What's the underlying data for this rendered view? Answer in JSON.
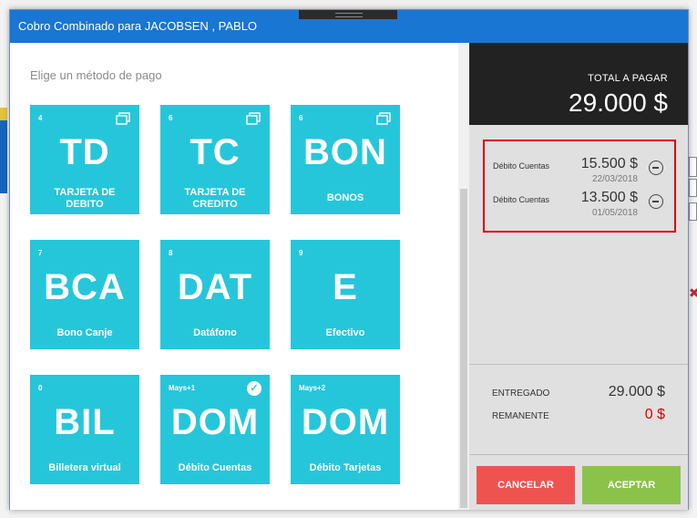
{
  "window": {
    "title": "Cobro Combinado para JACOBSEN , PABLO"
  },
  "left_panel": {
    "subtitle": "Elige un método de pago",
    "tiles": [
      {
        "key": "4",
        "code": "TD",
        "label": "TARJETA DE DEBITO",
        "label_lines": [
          "TARJETA DE",
          "DEBITO"
        ],
        "icon": "duplicate-icon"
      },
      {
        "key": "6",
        "code": "TC",
        "label": "TARJETA DE CREDITO",
        "label_lines": [
          "TARJETA DE",
          "CREDITO"
        ],
        "icon": "duplicate-icon"
      },
      {
        "key": "6",
        "code": "BON",
        "label": "BONOS",
        "label_lines": [
          "BONOS"
        ],
        "icon": "duplicate-icon"
      },
      {
        "key": "7",
        "code": "BCA",
        "label": "Bono Canje",
        "label_lines": [
          "Bono Canje"
        ]
      },
      {
        "key": "8",
        "code": "DAT",
        "label": "Datáfono",
        "label_lines": [
          "Datáfono"
        ]
      },
      {
        "key": "9",
        "code": "E",
        "label": "Efectivo",
        "label_lines": [
          "Efectivo"
        ]
      },
      {
        "key": "0",
        "code": "BIL",
        "label": "Billetera virtual",
        "label_lines": [
          "Billetera virtual"
        ]
      },
      {
        "key": "Mays+1",
        "code": "DOM",
        "label": "Débito Cuentas",
        "label_lines": [
          "Débito Cuentas"
        ],
        "icon": "check-icon",
        "selected": true
      },
      {
        "key": "Mays+2",
        "code": "DOM",
        "label": "Débito Tarjetas",
        "label_lines": [
          "Débito Tarjetas"
        ]
      }
    ]
  },
  "right_panel": {
    "total_label": "TOTAL A PAGAR",
    "total_value": "29.000 $",
    "payments": [
      {
        "method": "Débito Cuentas",
        "amount": "15.500 $",
        "date": "22/03/2018"
      },
      {
        "method": "Débito Cuentas",
        "amount": "13.500 $",
        "date": "01/05/2018"
      }
    ],
    "delivered_label": "ENTREGADO",
    "delivered_value": "29.000 $",
    "remaining_label": "REMANENTE",
    "remaining_value": "0 $",
    "cancel_label": "CANCELAR",
    "accept_label": "ACEPTAR"
  },
  "colors": {
    "title_bar": "#1976d2",
    "tile": "#26c6da",
    "cancel": "#ef5350",
    "accept": "#8bc34a",
    "remaining": "#e00000",
    "highlight_border": "#e00000"
  }
}
